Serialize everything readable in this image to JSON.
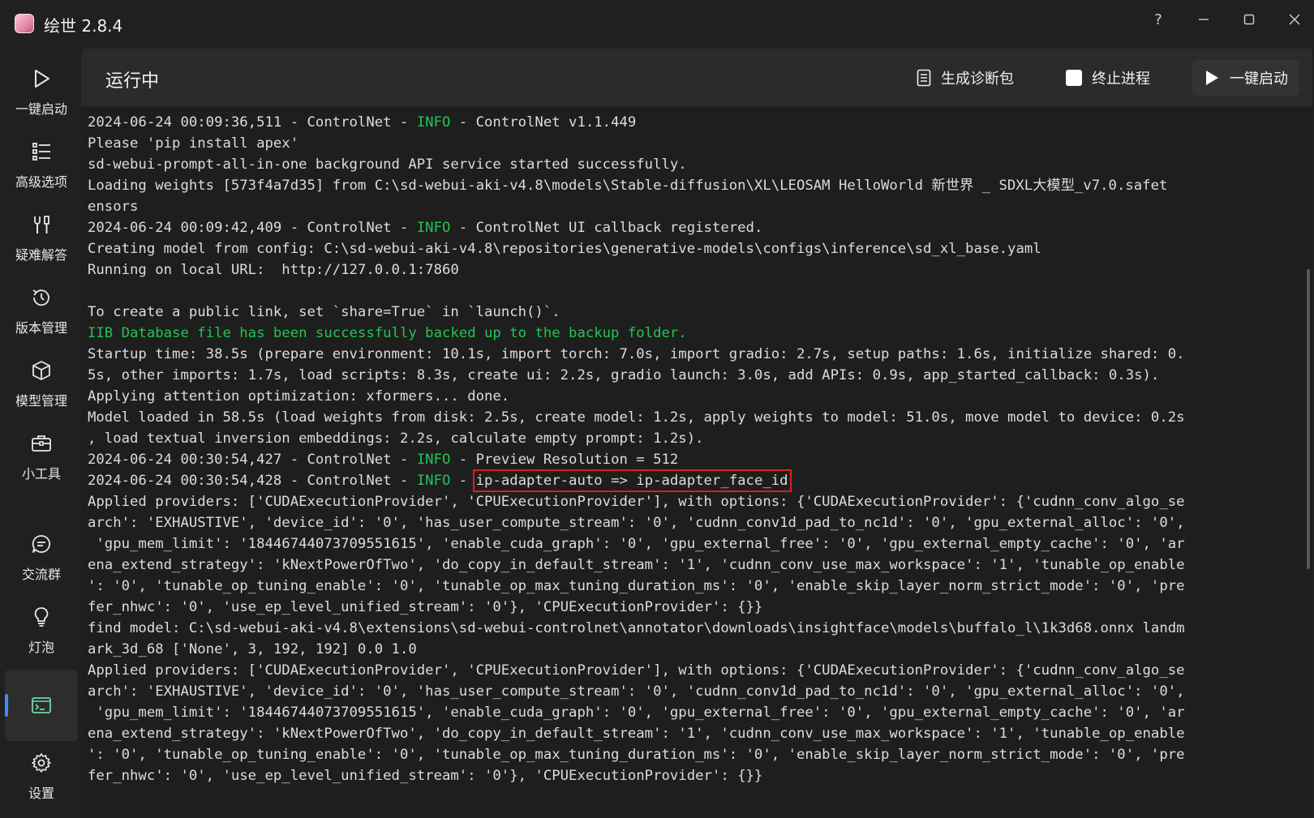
{
  "window": {
    "title": "绘世 2.8.4",
    "controls": {
      "help": "?",
      "minimize": "—",
      "maximize": "☐",
      "close": "✕"
    }
  },
  "sidebar": {
    "items": [
      {
        "label": "一键启动",
        "icon": "play-icon"
      },
      {
        "label": "高级选项",
        "icon": "list-icon"
      },
      {
        "label": "疑难解答",
        "icon": "tools-icon"
      },
      {
        "label": "版本管理",
        "icon": "history-icon"
      },
      {
        "label": "模型管理",
        "icon": "cube-icon"
      },
      {
        "label": "小工具",
        "icon": "toolbox-icon"
      },
      {
        "label": "交流群",
        "icon": "chat-icon"
      },
      {
        "label": "灯泡",
        "icon": "bulb-icon"
      },
      {
        "label": "",
        "icon": "console-icon",
        "active": true
      },
      {
        "label": "设置",
        "icon": "gear-icon"
      }
    ]
  },
  "toolbar": {
    "status": "运行中",
    "diag_label": "生成诊断包",
    "stop_label": "终止进程",
    "start_label": "一键启动"
  },
  "console": {
    "lines": [
      {
        "parts": [
          {
            "t": "2024-06-24 00:09:36,511 - ControlNet - "
          },
          {
            "t": "INFO",
            "c": "info"
          },
          {
            "t": " - ControlNet v1.1.449"
          }
        ]
      },
      {
        "parts": [
          {
            "t": "Please 'pip install apex'"
          }
        ]
      },
      {
        "parts": [
          {
            "t": "sd-webui-prompt-all-in-one background API service started successfully."
          }
        ]
      },
      {
        "parts": [
          {
            "t": "Loading weights [573f4a7d35] from C:\\sd-webui-aki-v4.8\\models\\Stable-diffusion\\XL\\LEOSAM HelloWorld 新世界 _ SDXL大模型_v7.0.safet"
          }
        ]
      },
      {
        "parts": [
          {
            "t": "ensors"
          }
        ]
      },
      {
        "parts": [
          {
            "t": "2024-06-24 00:09:42,409 - ControlNet - "
          },
          {
            "t": "INFO",
            "c": "info"
          },
          {
            "t": " - ControlNet UI callback registered."
          }
        ]
      },
      {
        "parts": [
          {
            "t": "Creating model from config: C:\\sd-webui-aki-v4.8\\repositories\\generative-models\\configs\\inference\\sd_xl_base.yaml"
          }
        ]
      },
      {
        "parts": [
          {
            "t": "Running on local URL:  http://127.0.0.1:7860"
          }
        ]
      },
      {
        "parts": [
          {
            "t": ""
          }
        ]
      },
      {
        "parts": [
          {
            "t": "To create a public link, set `share=True` in `launch()`."
          }
        ]
      },
      {
        "parts": [
          {
            "t": "IIB Database file has been successfully backed up to the backup folder.",
            "c": "green"
          }
        ]
      },
      {
        "parts": [
          {
            "t": "Startup time: 38.5s (prepare environment: 10.1s, import torch: 7.0s, import gradio: 2.7s, setup paths: 1.6s, initialize shared: 0."
          }
        ]
      },
      {
        "parts": [
          {
            "t": "5s, other imports: 1.7s, load scripts: 8.3s, create ui: 2.2s, gradio launch: 3.0s, add APIs: 0.9s, app_started_callback: 0.3s)."
          }
        ]
      },
      {
        "parts": [
          {
            "t": "Applying attention optimization: xformers... done."
          }
        ]
      },
      {
        "parts": [
          {
            "t": "Model loaded in 58.5s (load weights from disk: 2.5s, create model: 1.2s, apply weights to model: 51.0s, move model to device: 0.2s"
          }
        ]
      },
      {
        "parts": [
          {
            "t": ", load textual inversion embeddings: 2.2s, calculate empty prompt: 1.2s)."
          }
        ]
      },
      {
        "parts": [
          {
            "t": "2024-06-24 00:30:54,427 - ControlNet - "
          },
          {
            "t": "INFO",
            "c": "info"
          },
          {
            "t": " - Preview Resolution = 512"
          }
        ]
      },
      {
        "parts": [
          {
            "t": "2024-06-24 00:30:54,428 - ControlNet - "
          },
          {
            "t": "INFO",
            "c": "info"
          },
          {
            "t": " - "
          },
          {
            "t": "ip-adapter-auto => ip-adapter_face_id",
            "c": "highlight"
          }
        ]
      },
      {
        "parts": [
          {
            "t": "Applied providers: ['CUDAExecutionProvider', 'CPUExecutionProvider'], with options: {'CUDAExecutionProvider': {'cudnn_conv_algo_se"
          }
        ]
      },
      {
        "parts": [
          {
            "t": "arch': 'EXHAUSTIVE', 'device_id': '0', 'has_user_compute_stream': '0', 'cudnn_conv1d_pad_to_nc1d': '0', 'gpu_external_alloc': '0',"
          }
        ]
      },
      {
        "parts": [
          {
            "t": " 'gpu_mem_limit': '18446744073709551615', 'enable_cuda_graph': '0', 'gpu_external_free': '0', 'gpu_external_empty_cache': '0', 'ar"
          }
        ]
      },
      {
        "parts": [
          {
            "t": "ena_extend_strategy': 'kNextPowerOfTwo', 'do_copy_in_default_stream': '1', 'cudnn_conv_use_max_workspace': '1', 'tunable_op_enable"
          }
        ]
      },
      {
        "parts": [
          {
            "t": "': '0', 'tunable_op_tuning_enable': '0', 'tunable_op_max_tuning_duration_ms': '0', 'enable_skip_layer_norm_strict_mode': '0', 'pre"
          }
        ]
      },
      {
        "parts": [
          {
            "t": "fer_nhwc': '0', 'use_ep_level_unified_stream': '0'}, 'CPUExecutionProvider': {}}"
          }
        ]
      },
      {
        "parts": [
          {
            "t": "find model: C:\\sd-webui-aki-v4.8\\extensions\\sd-webui-controlnet\\annotator\\downloads\\insightface\\models\\buffalo_l\\1k3d68.onnx landm"
          }
        ]
      },
      {
        "parts": [
          {
            "t": "ark_3d_68 ['None', 3, 192, 192] 0.0 1.0"
          }
        ]
      },
      {
        "parts": [
          {
            "t": "Applied providers: ['CUDAExecutionProvider', 'CPUExecutionProvider'], with options: {'CUDAExecutionProvider': {'cudnn_conv_algo_se"
          }
        ]
      },
      {
        "parts": [
          {
            "t": "arch': 'EXHAUSTIVE', 'device_id': '0', 'has_user_compute_stream': '0', 'cudnn_conv1d_pad_to_nc1d': '0', 'gpu_external_alloc': '0',"
          }
        ]
      },
      {
        "parts": [
          {
            "t": " 'gpu_mem_limit': '18446744073709551615', 'enable_cuda_graph': '0', 'gpu_external_free': '0', 'gpu_external_empty_cache': '0', 'ar"
          }
        ]
      },
      {
        "parts": [
          {
            "t": "ena_extend_strategy': 'kNextPowerOfTwo', 'do_copy_in_default_stream': '1', 'cudnn_conv_use_max_workspace': '1', 'tunable_op_enable"
          }
        ]
      },
      {
        "parts": [
          {
            "t": "': '0', 'tunable_op_tuning_enable': '0', 'tunable_op_max_tuning_duration_ms': '0', 'enable_skip_layer_norm_strict_mode': '0', 'pre"
          }
        ]
      },
      {
        "parts": [
          {
            "t": "fer_nhwc': '0', 'use_ep_level_unified_stream': '0'}, 'CPUExecutionProvider': {}}"
          }
        ]
      }
    ]
  },
  "colors": {
    "info": "#23c552",
    "highlight_border": "#e01e1e",
    "accent": "#3d8bfd"
  }
}
